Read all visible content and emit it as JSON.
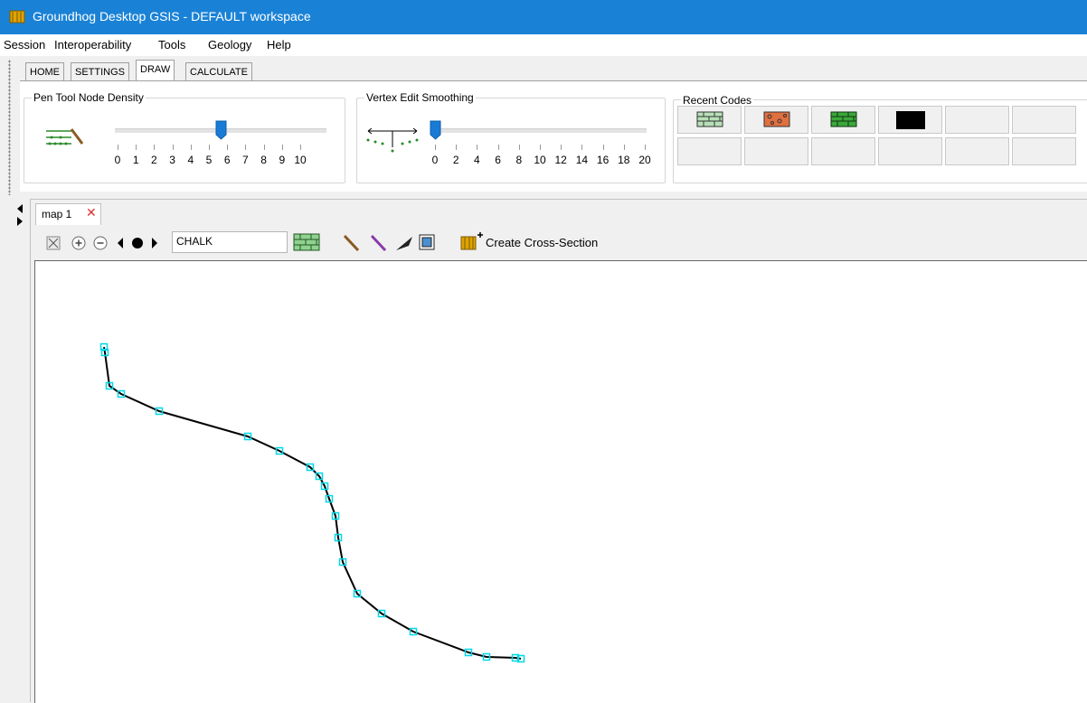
{
  "window": {
    "title": "Groundhog Desktop GSIS - DEFAULT workspace"
  },
  "menu": [
    "Session",
    "Interoperability",
    "Tools",
    "Geology",
    "Help"
  ],
  "ribbon": {
    "tabs": [
      "HOME",
      "SETTINGS",
      "DRAW",
      "CALCULATE"
    ],
    "active_tab": "DRAW",
    "pen_density": {
      "label": "Pen Tool Node Density",
      "ticks": [
        "0",
        "1",
        "2",
        "3",
        "4",
        "5",
        "6",
        "7",
        "8",
        "9",
        "10"
      ],
      "value": 5
    },
    "vertex_smoothing": {
      "label": "Vertex Edit Smoothing",
      "ticks": [
        "0",
        "2",
        "4",
        "6",
        "8",
        "10",
        "12",
        "14",
        "16",
        "18",
        "20"
      ],
      "value": 0
    },
    "recent_codes": {
      "label": "Recent Codes",
      "swatches": [
        "chalk-brick",
        "orange-rock",
        "green-brick",
        "black",
        "",
        "",
        "",
        "",
        "",
        "",
        "",
        ""
      ]
    }
  },
  "map": {
    "tab_label": "map 1",
    "code_input": "CHALK",
    "create_section_label": "Create Cross-Section"
  },
  "polyline": [
    [
      114,
      383
    ],
    [
      115,
      389
    ],
    [
      120,
      426
    ],
    [
      133,
      435
    ],
    [
      175,
      454
    ],
    [
      273,
      482
    ],
    [
      308,
      498
    ],
    [
      342,
      516
    ],
    [
      352,
      526
    ],
    [
      358,
      537
    ],
    [
      363,
      551
    ],
    [
      370,
      570
    ],
    [
      373,
      594
    ],
    [
      378,
      621
    ],
    [
      394,
      656
    ],
    [
      421,
      678
    ],
    [
      456,
      698
    ],
    [
      517,
      721
    ],
    [
      537,
      726
    ],
    [
      569,
      727
    ],
    [
      575,
      728
    ]
  ]
}
